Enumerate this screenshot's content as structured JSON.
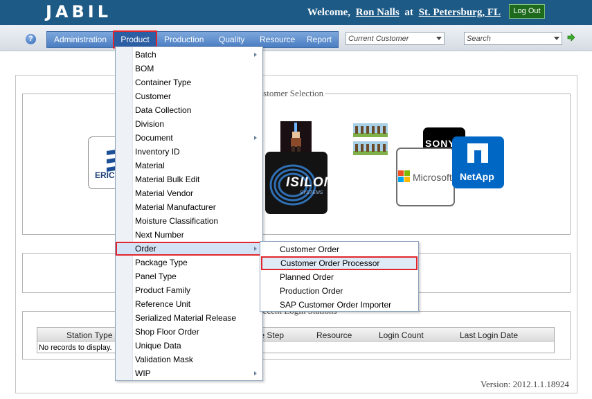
{
  "header": {
    "logo": "JABIL",
    "welcome_prefix": "Welcome,",
    "user_name": "Ron Nalls",
    "at": "at",
    "location": "St. Petersburg, FL",
    "logout_label": "Log Out"
  },
  "nav": {
    "items": [
      "Administration",
      "Product",
      "Production",
      "Quality",
      "Resource",
      "Report"
    ],
    "customer_combo": "Current Customer",
    "search_combo": "Search"
  },
  "product_menu": {
    "items": [
      "Batch",
      "BOM",
      "Container Type",
      "Customer",
      "Data Collection",
      "Division",
      "Document",
      "Inventory ID",
      "Material",
      "Material Bulk Edit",
      "Material Vendor",
      "Material Manufacturer",
      "Moisture Classification",
      "Next Number",
      "Order",
      "Package Type",
      "Panel Type",
      "Product Family",
      "Reference Unit",
      "Serialized Material Release",
      "Shop Floor Order",
      "Unique Data",
      "Validation Mask",
      "WIP"
    ],
    "submenu_indices": [
      0,
      6,
      14,
      23
    ],
    "open_index": 14
  },
  "order_submenu": {
    "items": [
      "Customer Order",
      "Customer Order Processor",
      "Planned Order",
      "Production Order",
      "SAP Customer Order Importer"
    ],
    "selected_index": 1
  },
  "customer_selection": {
    "legend": "Customer Selection",
    "logos": {
      "ericsson": "ERICS",
      "isilon": "ISILON",
      "isilon_sub": "SYSTEMS",
      "sony": "SONY",
      "microsoft": "Microsoft",
      "netapp": "NetApp"
    }
  },
  "recent_stations": {
    "legend": "Recent Login Stations",
    "columns": [
      "Station Type",
      "Route Step",
      "Resource",
      "Login Count",
      "Last Login Date"
    ],
    "empty_text": "No records to display."
  },
  "version": "Version: 2012.1.1.18924",
  "colors": {
    "header_bg": "#1d5a86",
    "menu_bg": "#5f8fd0",
    "highlight": "#e0262c",
    "logout_bg": "#1d6a1d"
  }
}
